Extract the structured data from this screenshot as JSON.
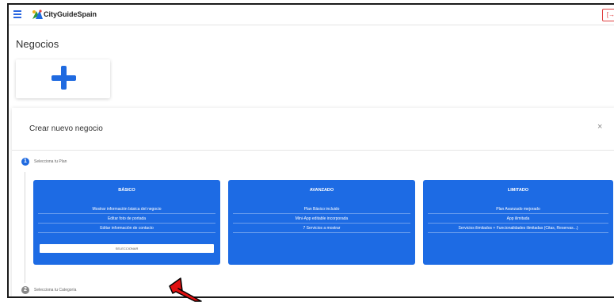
{
  "topbar": {
    "app_title": "CityGuideSpain",
    "menu_icon": "hamburger-menu-icon",
    "logout_icon": "logout-icon",
    "logout_label": "[→"
  },
  "page": {
    "title": "Negocios",
    "add_icon": "plus-icon"
  },
  "dialog": {
    "title": "Crear nuevo negocio",
    "close_label": "×",
    "steps": [
      {
        "number": "1",
        "label": "Selecciona tu Plan",
        "active": true
      },
      {
        "number": "2",
        "label": "Selecciona tu Categoría",
        "active": false
      }
    ],
    "plans": [
      {
        "name": "BÁSICO",
        "features": [
          "Mostrar información básica del negocio",
          "Editar foto de portada",
          "Editar información de contacto"
        ],
        "select_label": "SELECCIONAR"
      },
      {
        "name": "AVANZADO",
        "features": [
          "Plan Básico incluido",
          "Mini-App editable incorporada",
          "7 Servicios a mostrar"
        ]
      },
      {
        "name": "LIMITADO",
        "features": [
          "Plan Avanzado mejorado",
          "App ilimitada",
          "Servicios ilimitados + Funcionalidades ilimitadas (Citas, Reservas...)"
        ]
      }
    ]
  },
  "colors": {
    "accent": "#1f6ae0",
    "plan_card": "#1d6be4",
    "logout": "#e04040",
    "annotation_arrow": "#e01010"
  }
}
